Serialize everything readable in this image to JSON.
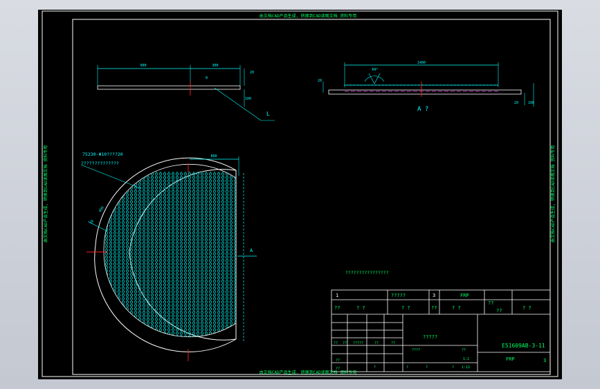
{
  "watermarks": {
    "top": "由文档CAD产品生成, 转换到CAD读图文档 资料专用",
    "left": "由文档CAD产品生成, 转换到CAD读图文档 资料专用",
    "right": "由文档CAD产品生成, 转换到CAD读图文档 资料专用",
    "bottom": "由文档CAD产品生成, 转换到CAD读图文档 资料专用"
  },
  "dimensions": {
    "side_view_length": "900",
    "side_view_right": "300",
    "side_view_height": "20",
    "side_view_detail": "100",
    "side_view_small": "8",
    "side_view_tag": "L",
    "section_length": "1400",
    "section_angle": "60°",
    "section_left": "20",
    "section_right": "20",
    "section_far_right": "100",
    "section_label": "A ?",
    "plate_top": "800",
    "plate_left_a": "400",
    "plate_left_b": "20",
    "arrow_label": "A"
  },
  "notes": {
    "hole_spec": "75230-Φ10????20",
    "hole_note": "??????????????",
    "tech_note": "????????????????"
  },
  "title_block": {
    "row1": [
      "1",
      "?????",
      "3",
      "FRP"
    ],
    "row2": [
      "??",
      "?  ?",
      "?  ?",
      "??",
      "?  ?",
      "??",
      "??",
      "?  ?"
    ],
    "part_name": "?????",
    "drawing_no": "E51609AB-3-11",
    "material": "FRP",
    "sheet": "3",
    "cells_small": [
      "??",
      "??",
      "?????",
      "??",
      "??",
      "????",
      "??",
      "1:2",
      "??",
      "??",
      "?",
      "?",
      "?",
      "?",
      "1:12"
    ]
  },
  "colors": {
    "border": "#ffffff",
    "dimension": "#00ffff",
    "mark": "#ff2020",
    "text": "#00ff66",
    "hatch": "#00e0e0",
    "hidden": "#ff40ff"
  }
}
